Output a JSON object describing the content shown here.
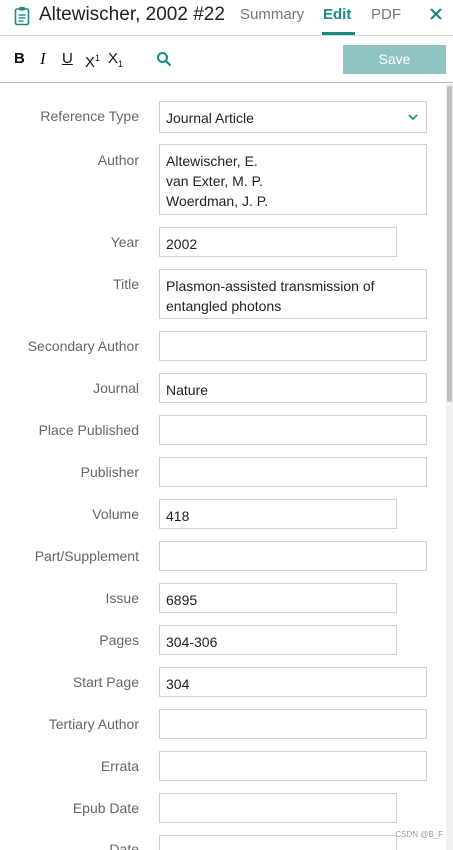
{
  "header": {
    "title": "Altewischer, 2002 #22",
    "tabs": [
      "Summary",
      "Edit",
      "PDF"
    ],
    "active_tab": "Edit",
    "icons": {
      "document": "clipboard-icon",
      "close": "close-icon"
    },
    "accent_color": "#1a8a86"
  },
  "toolbar": {
    "bold": "B",
    "italic": "I",
    "underline": "U",
    "superscript": "X",
    "superscript_mark": "1",
    "subscript": "X",
    "subscript_mark": "1",
    "search_icon": "search-icon",
    "save_label": "Save",
    "save_color": "#8fc4c2"
  },
  "form": {
    "reference_type": {
      "label": "Reference Type",
      "value": "Journal Article"
    },
    "author": {
      "label": "Author",
      "lines": [
        "Altewischer, E.",
        "van Exter, M. P.",
        "Woerdman, J. P."
      ]
    },
    "year": {
      "label": "Year",
      "value": "2002"
    },
    "title": {
      "label": "Title",
      "lines": [
        "Plasmon-assisted transmission of",
        "entangled photons"
      ]
    },
    "secondary_author": {
      "label": "Secondary Author",
      "value": ""
    },
    "journal": {
      "label": "Journal",
      "value": "Nature"
    },
    "place_published": {
      "label": "Place Published",
      "value": ""
    },
    "publisher": {
      "label": "Publisher",
      "value": ""
    },
    "volume": {
      "label": "Volume",
      "value": "418"
    },
    "part_supplement": {
      "label": "Part/Supplement",
      "value": ""
    },
    "issue": {
      "label": "Issue",
      "value": "6895"
    },
    "pages": {
      "label": "Pages",
      "value": "304-306"
    },
    "start_page": {
      "label": "Start Page",
      "value": "304"
    },
    "tertiary_author": {
      "label": "Tertiary Author",
      "value": ""
    },
    "errata": {
      "label": "Errata",
      "value": ""
    },
    "epub_date": {
      "label": "Epub Date",
      "value": ""
    },
    "date": {
      "label": "Date",
      "value": ""
    }
  },
  "watermark": "CSDN @B_F"
}
